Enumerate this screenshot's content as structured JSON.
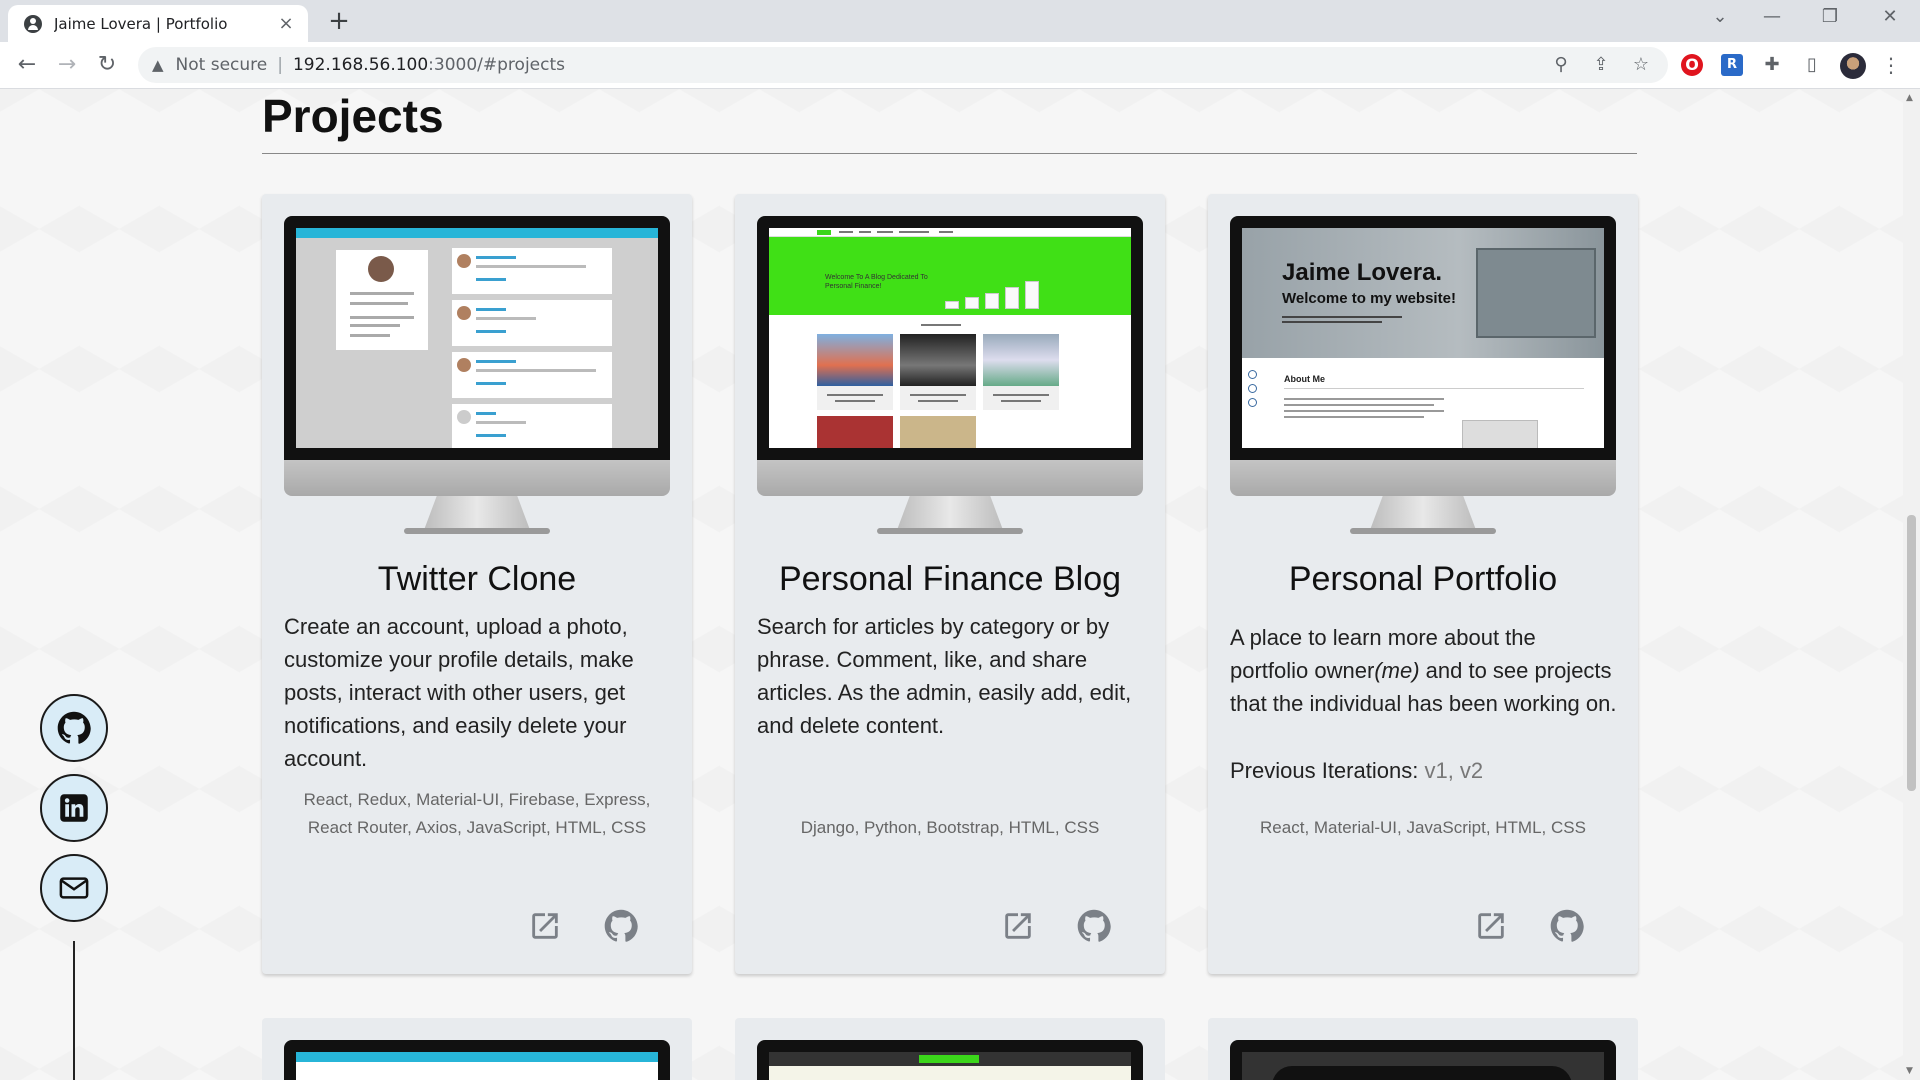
{
  "browser": {
    "tab_title": "Jaime Lovera | Portfolio",
    "new_tab": "+",
    "tab_close": "×",
    "not_secure": "Not secure",
    "url_host": "192.168.56.100",
    "url_path": ":3000/#projects"
  },
  "page": {
    "section_title": "Projects"
  },
  "social": [
    {
      "name": "github-icon"
    },
    {
      "name": "linkedin-icon"
    },
    {
      "name": "mail-icon"
    }
  ],
  "projects": [
    {
      "title": "Twitter Clone",
      "description": "Create an account, upload a photo, customize your profile details, make posts, interact with other users, get notifications, and easily delete your account.",
      "tech_line1": "React, Redux, Material-UI, Firebase, Express,",
      "tech_line2": "React Router, Axios, JavaScript, HTML, CSS"
    },
    {
      "title": "Personal Finance Blog",
      "description": "Search for articles by category or by phrase. Comment, like, and share articles. As the admin, easily add, edit, and delete content.",
      "tech_line1": "Django, Python, Bootstrap, HTML, CSS",
      "screen_hero_line1": "Welcome To A Blog Dedicated To",
      "screen_hero_line2": "Personal Finance!"
    },
    {
      "title": "Personal Portfolio",
      "description_pre": "A place to learn more about the portfolio owner",
      "description_em": "(me)",
      "description_post": " and to see projects that the individual has been working on.",
      "iterations_label": "Previous Iterations: ",
      "iteration_v1": "v1",
      "iteration_sep": ", ",
      "iteration_v2": "v2",
      "tech_line1": "React, Material-UI, JavaScript, HTML, CSS",
      "screen_h1": "Jaime Lovera.",
      "screen_h2": "Welcome to my website!",
      "screen_about": "About Me"
    }
  ],
  "colors": {
    "twitter_bar": "#27b5d8",
    "finance_green": "#40e016",
    "social_bg": "#d9ecf7",
    "card_bg": "#e8ebee"
  }
}
